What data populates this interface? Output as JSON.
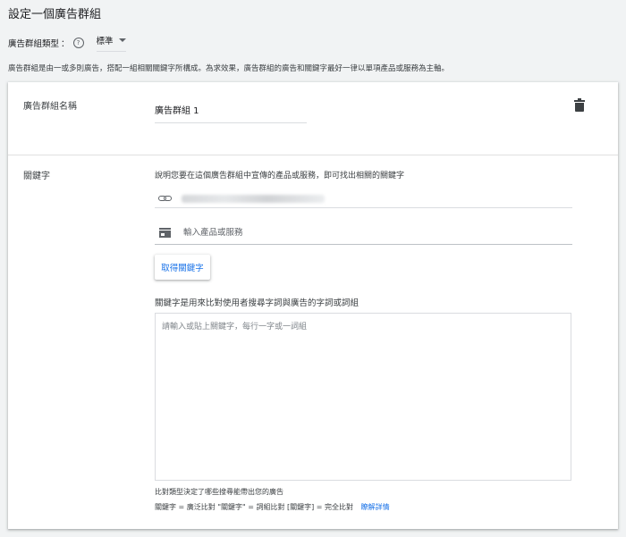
{
  "page_title": "設定一個廣告群組",
  "ad_group_type": {
    "label": "廣告群組類型",
    "help_glyph": "?",
    "selected": "標準"
  },
  "description": "廣告群組是由一或多則廣告，搭配一組相關關鍵字所構成。為求效果，廣告群組的廣告和關鍵字最好一律以單項產品或服務為主軸。",
  "card": {
    "name_label": "廣告群組名稱",
    "name_value": "廣告群組 1",
    "keywords_label": "關鍵字",
    "keywords_instruction": "說明您要在這個廣告群組中宣傳的產品或服務，即可找出相關的關鍵字",
    "product_placeholder": "輸入產品或服務",
    "get_keywords_button": "取得關鍵字",
    "keywords_help": "關鍵字是用來比對使用者搜尋字詞與廣告的字詞或詞組",
    "keywords_placeholder": "請輸入或貼上關鍵字，每行一字或一詞組",
    "match_type_note": "比對類型決定了哪些搜尋能帶出您的廣告",
    "match_type_examples": "關鍵字 = 廣泛比對 \"關鍵字\" = 詞組比對 [關鍵字] = 完全比對",
    "learn_more": "瞭解詳情"
  },
  "icons": {
    "help": "help-icon",
    "dropdown": "caret-down-icon",
    "delete": "trash-icon",
    "link": "link-icon",
    "store": "store-icon"
  },
  "colors": {
    "accent": "#1a73e8",
    "background": "#f1f3f4",
    "card": "#ffffff"
  }
}
